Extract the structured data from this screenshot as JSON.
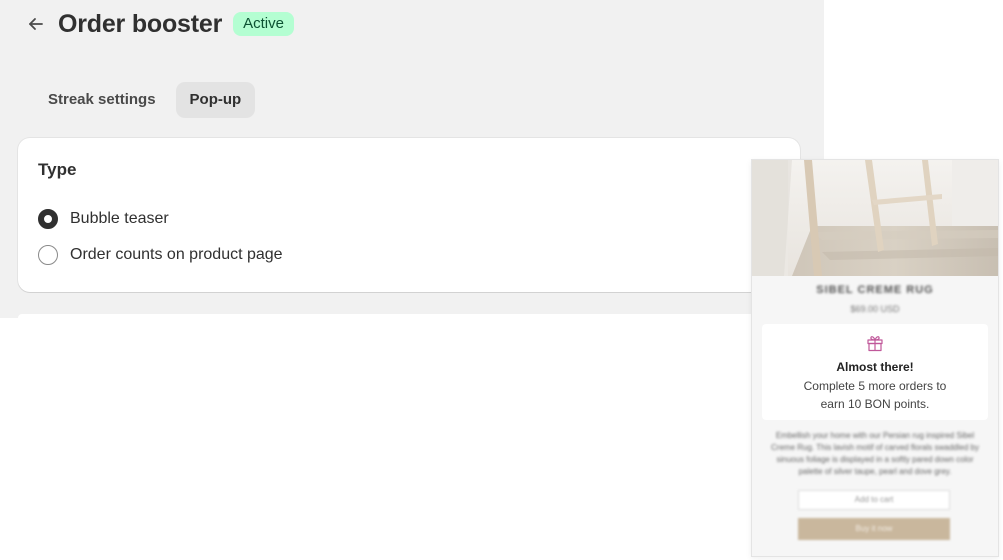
{
  "header": {
    "title": "Order booster",
    "status": "Active"
  },
  "tabs": [
    {
      "label": "Streak settings",
      "selected": false
    },
    {
      "label": "Pop-up",
      "selected": true
    }
  ],
  "type_card": {
    "title": "Type",
    "options": [
      {
        "label": "Bubble teaser",
        "checked": true
      },
      {
        "label": "Order counts on product page",
        "checked": false
      }
    ]
  },
  "preview": {
    "product_name": "SIBEL CREME RUG",
    "product_price": "$69.00 USD",
    "popup": {
      "icon": "gift-icon",
      "heading": "Almost there!",
      "line1": "Complete 5 more orders to",
      "line2": "earn 10 BON points."
    },
    "description": "Embellish your home with our Persian rug inspired Sibel Creme Rug. This lavish motif of carved florals swaddled by sinuous foliage is displayed in a softly pared down color palette of silver taupe, pearl and dove grey.",
    "quantity_placeholder": "Add to cart",
    "buy_label": "Buy it now"
  },
  "colors": {
    "canvas": "#f1f1f1",
    "badge_bg": "#b4fed2",
    "badge_text": "#0c5132",
    "tab_selected_bg": "#e3e3e3",
    "buy_button": "#c9b79d",
    "gift_icon": "#c0589a"
  }
}
